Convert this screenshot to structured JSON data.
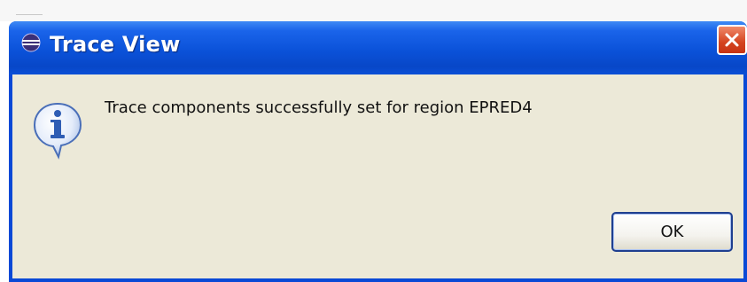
{
  "dialog": {
    "title": "Trace View",
    "app_icon": "eclipse-icon",
    "close_icon": "close-icon",
    "message_icon": "info-icon",
    "message": "Trace components successfully set for region EPRED4",
    "ok_label": "OK"
  },
  "colors": {
    "titlebar": "#0b52d9",
    "close_button": "#d4431f",
    "body": "#ece9d8"
  }
}
